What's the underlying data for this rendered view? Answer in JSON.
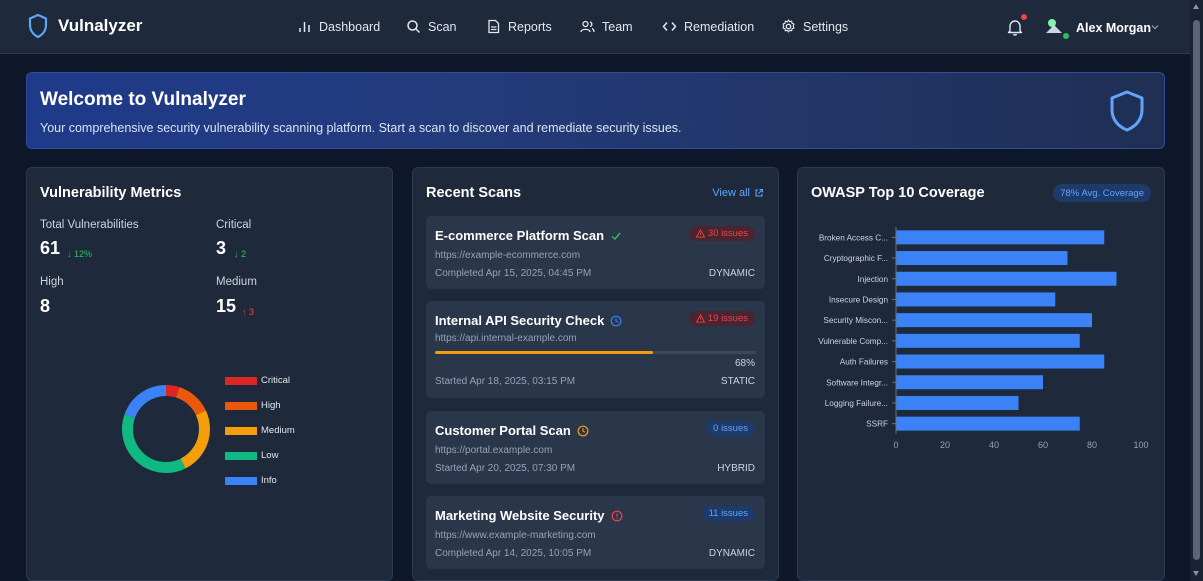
{
  "app": {
    "name": "Vulnalyzer"
  },
  "nav": {
    "items": [
      {
        "label": "Dashboard",
        "icon": "bar-chart-icon"
      },
      {
        "label": "Scan",
        "icon": "search-icon"
      },
      {
        "label": "Reports",
        "icon": "document-icon"
      },
      {
        "label": "Team",
        "icon": "users-icon"
      },
      {
        "label": "Remediation",
        "icon": "code-icon"
      },
      {
        "label": "Settings",
        "icon": "gear-icon"
      }
    ],
    "user": {
      "name": "Alex Morgan",
      "avatar_alt": "Ale"
    }
  },
  "welcome": {
    "title": "Welcome to Vulnalyzer",
    "subtitle": "Your comprehensive security vulnerability scanning platform. Start a scan to discover and remediate security issues."
  },
  "metrics": {
    "title": "Vulnerability Metrics",
    "total": {
      "label": "Total Vulnerabilities",
      "value": "61",
      "delta": "↓ 12%"
    },
    "critical": {
      "label": "Critical",
      "value": "3",
      "delta": "↓ 2"
    },
    "high": {
      "label": "High",
      "value": "8"
    },
    "medium": {
      "label": "Medium",
      "value": "15",
      "delta": "↑ 3"
    },
    "legend": [
      {
        "label": "Critical",
        "color": "#dc2626"
      },
      {
        "label": "High",
        "color": "#ea580c"
      },
      {
        "label": "Medium",
        "color": "#f59e0b"
      },
      {
        "label": "Low",
        "color": "#10b981"
      },
      {
        "label": "Info",
        "color": "#3b82f6"
      }
    ],
    "donut": [
      {
        "label": "Critical",
        "value": 3,
        "color": "#dc2626"
      },
      {
        "label": "High",
        "value": 8,
        "color": "#ea580c"
      },
      {
        "label": "Medium",
        "value": 15,
        "color": "#f59e0b"
      },
      {
        "label": "Low",
        "value": 23,
        "color": "#10b981"
      },
      {
        "label": "Info",
        "value": 12,
        "color": "#3b82f6"
      }
    ]
  },
  "recent_scans": {
    "title": "Recent Scans",
    "view_all": "View all",
    "items": [
      {
        "name": "E-commerce Platform Scan",
        "status_icon": "check-icon",
        "url": "https://example-ecommerce.com",
        "time": "Completed Apr 15, 2025, 04:45 PM",
        "type": "DYNAMIC",
        "issues": "30 issues",
        "severity": "red"
      },
      {
        "name": "Internal API Security Check",
        "status_icon": "clock-icon",
        "url": "https://api.internal-example.com",
        "time": "Started Apr 18, 2025, 03:15 PM",
        "type": "STATIC",
        "issues": "19 issues",
        "severity": "red",
        "progress": 68,
        "progress_label": "68%"
      },
      {
        "name": "Customer Portal Scan",
        "status_icon": "pending-clock-icon",
        "url": "https://portal.example.com",
        "time": "Started Apr 20, 2025, 07:30 PM",
        "type": "HYBRID",
        "issues": "0 issues",
        "severity": "blue"
      },
      {
        "name": "Marketing Website Security",
        "status_icon": "alert-circle-icon",
        "url": "https://www.example-marketing.com",
        "time": "Completed Apr 14, 2025, 10:05 PM",
        "type": "DYNAMIC",
        "issues": "11 issues",
        "severity": "blue"
      }
    ]
  },
  "owasp": {
    "title": "OWASP Top 10 Coverage",
    "badge": "78% Avg. Coverage"
  },
  "chart_data": {
    "type": "bar",
    "orientation": "horizontal",
    "categories": [
      "Broken Access C...",
      "Cryptographic F...",
      "Injection",
      "Insecure Design",
      "Security Miscon...",
      "Vulnerable Comp...",
      "Auth Failures",
      "Software Integr...",
      "Logging Failure...",
      "SSRF"
    ],
    "values": [
      85,
      70,
      90,
      65,
      80,
      75,
      85,
      60,
      50,
      75
    ],
    "xlim": [
      0,
      100
    ],
    "xticks": [
      0,
      20,
      40,
      60,
      80,
      100
    ],
    "color": "#3b82f6",
    "grid": false
  }
}
